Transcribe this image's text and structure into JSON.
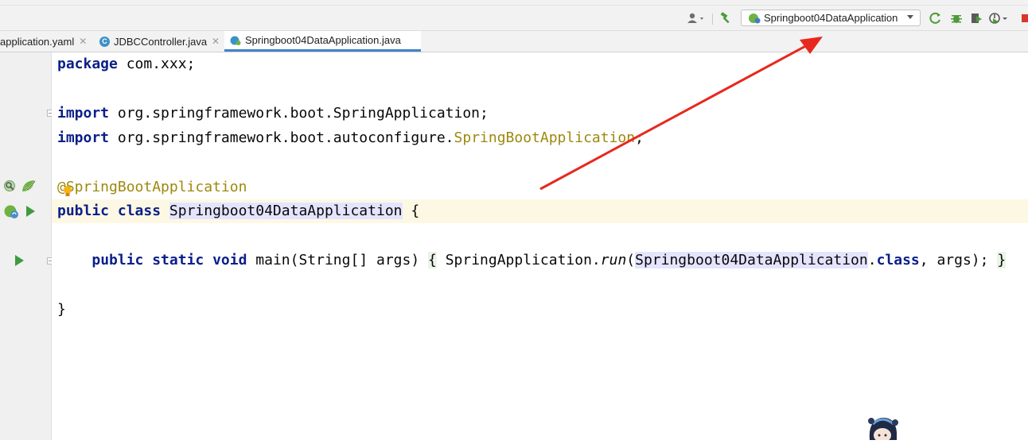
{
  "toolbar": {
    "user_icon": "user-icon",
    "build_icon": "hammer-icon",
    "run_config": {
      "label": "Springboot04DataApplication",
      "icon": "spring-boot-icon"
    },
    "actions": [
      "rerun-icon",
      "debug-icon",
      "coverage-icon",
      "profile-icon",
      "stop-icon"
    ]
  },
  "tabs": [
    {
      "label": "application.yaml",
      "active": false
    },
    {
      "label": "JDBCController.java",
      "active": false
    },
    {
      "label": "Springboot04DataApplication.java",
      "active": true
    }
  ],
  "code": {
    "l1_kw": "package",
    "l1_rest": " com.xxx;",
    "l3_kw": "import",
    "l3_rest": " org.springframework.boot.SpringApplication;",
    "l4_kw": "import",
    "l4_a": " org.springframework.boot.autoconfigure.",
    "l4_b": "SpringBootApplication",
    "l4_c": ";",
    "l6_ann": "@SpringBootApplication",
    "l7_kw": "public class",
    "l7_name": "Springboot04DataApplication",
    "l7_rest": " {",
    "l9_indent": "    ",
    "l9_kw": "public static void",
    "l9_a": " main(String[] args) ",
    "l9_ob": "{",
    "l9_b": " SpringApplication.",
    "l9_run": "run",
    "l9_c": "(",
    "l9_name": "Springboot04DataApplication",
    "l9_d": ".",
    "l9_class": "class",
    "l9_e": ", args); ",
    "l9_cb": "}",
    "l11": "}"
  },
  "colors": {
    "keyword": "#0b1f89",
    "annotation": "#9e880d",
    "highlight": "#e4e4ff",
    "current_line": "#fdf8e4",
    "arrow": "#e8281e",
    "tab_accent": "#4083c9"
  }
}
